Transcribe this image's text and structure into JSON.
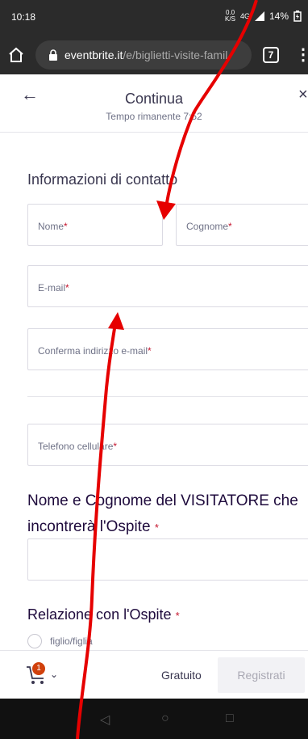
{
  "status_bar": {
    "time": "10:18",
    "speed": "0.0",
    "speed_unit": "K/S",
    "signal": "4G",
    "battery": "14%"
  },
  "browser": {
    "domain": "eventbrite.it",
    "path": "/e/biglietti-visite-famil",
    "tab_count": "7"
  },
  "header": {
    "title": "Continua",
    "timer": "Tempo rimanente 7:52"
  },
  "contact": {
    "title": "Informazioni di contatto",
    "first_name": "Nome",
    "last_name": "Cognome",
    "email": "E-mail",
    "confirm_email": "Conferma indirizzo e-mail",
    "mobile": "Telefono cellulare",
    "required_mark": "*"
  },
  "visitor_question": {
    "line1": "Nome e Cognome del VISITATORE che",
    "line2": "incontrerà l'Ospite",
    "required_mark": "*"
  },
  "relation": {
    "title": "Relazione con l'Ospite",
    "required_mark": "*",
    "options": [
      "figlio/figlia"
    ]
  },
  "footer": {
    "cart_count": "1",
    "price": "Gratuito",
    "register_label": "Registrati"
  },
  "colors": {
    "accent": "#d1410c",
    "annotation_arrow": "#e60000",
    "required": "#c5162e"
  }
}
